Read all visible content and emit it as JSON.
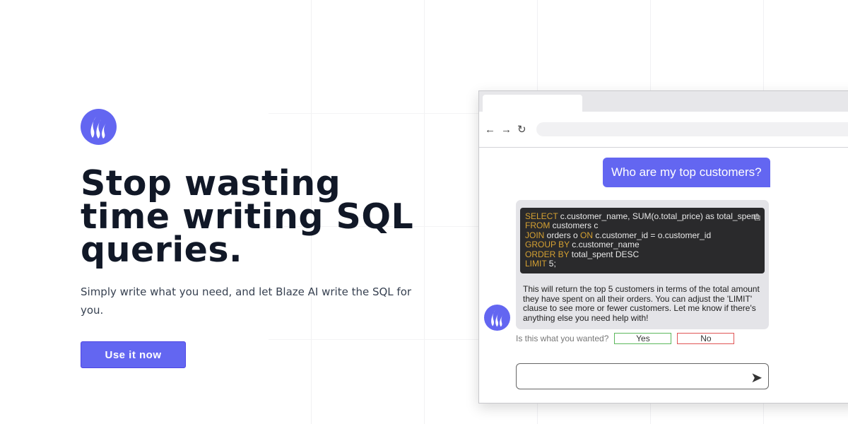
{
  "hero": {
    "title": "Stop wasting time writing SQL queries.",
    "subtitle": "Simply write what you need, and let Blaze AI write the SQL for you.",
    "cta": "Use it now"
  },
  "browser": {
    "back": "←",
    "forward": "→",
    "reload": "↻"
  },
  "chat": {
    "question": "Who are my top customers?",
    "code": [
      {
        "kw": "SELECT",
        "rest": " c.customer_name, SUM(o.total_price) as total_spent"
      },
      {
        "kw": "FROM",
        "rest": " customers c"
      },
      {
        "kw": "JOIN",
        "rest": " orders o ",
        "kw2": "ON",
        "rest2": " c.customer_id = o.customer_id"
      },
      {
        "kw": "GROUP BY",
        "rest": " c.customer_name"
      },
      {
        "kw": "ORDER BY",
        "rest": " total_spent DESC"
      },
      {
        "kw": "LIMIT",
        "rest": " 5;"
      }
    ],
    "answer": "This will return the top 5 customers in terms of the total amount they have spent on all their orders. You can adjust the 'LIMIT' clause to see more or fewer customers. Let me know if there's anything else you need help with!",
    "feedback_prompt": "Is this what you wanted?",
    "yes": "Yes",
    "no": "No",
    "input_value": ""
  },
  "colors": {
    "accent": "#6366f1",
    "keyword": "#d4a032"
  }
}
